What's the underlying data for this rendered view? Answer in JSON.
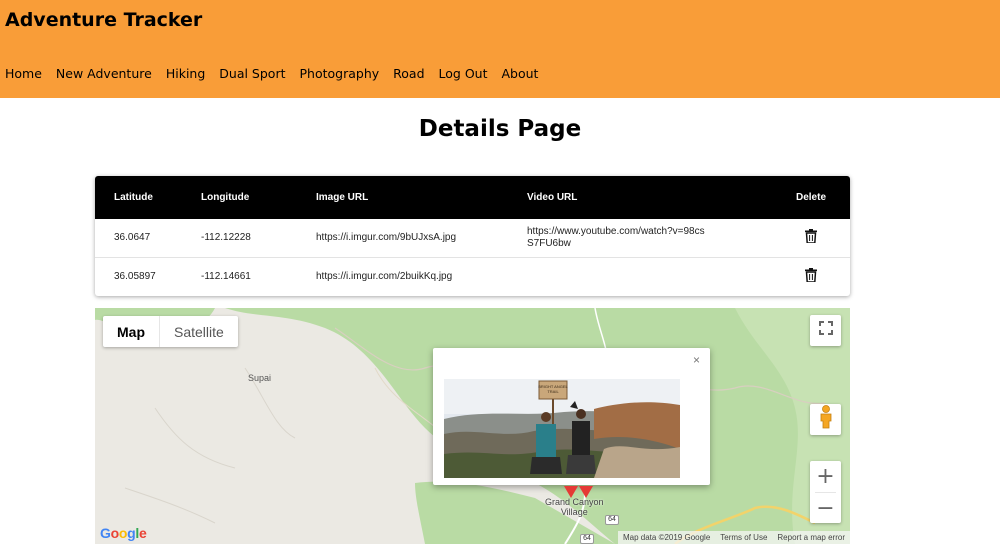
{
  "header": {
    "title": "Adventure Tracker",
    "nav": [
      "Home",
      "New Adventure",
      "Hiking",
      "Dual Sport",
      "Photography",
      "Road",
      "Log Out",
      "About"
    ],
    "bg_color": "#f99d38"
  },
  "page_title": "Details Page",
  "table": {
    "columns": [
      "Latitude",
      "Longitude",
      "Image URL",
      "Video URL",
      "Delete"
    ],
    "rows": [
      {
        "lat": "36.0647",
        "lng": "-112.12228",
        "image": "https://i.imgur.com/9bUJxsA.jpg",
        "video": "https://www.youtube.com/watch?v=98csS7FU6bw",
        "delete_icon": "trash-icon"
      },
      {
        "lat": "36.05897",
        "lng": "-112.14661",
        "image": "https://i.imgur.com/2buikKq.jpg",
        "video": "",
        "delete_icon": "trash-icon"
      }
    ]
  },
  "map": {
    "type_control": {
      "map": "Map",
      "satellite": "Satellite",
      "selected": "Map"
    },
    "places": {
      "supai": "Supai",
      "grand_canyon_line1": "Grand Canyon",
      "grand_canyon_line2": "Village",
      "route": "64"
    },
    "infowindow": {
      "close": "×",
      "photo_sign_line1": "BRIGHT ANGEL",
      "photo_sign_line2": "TRAIL"
    },
    "zoom_in": "+",
    "zoom_out": "−",
    "footer": {
      "data": "Map data ©2019 Google",
      "terms": "Terms of Use",
      "report": "Report a map error"
    },
    "logo": "Google",
    "marker_color": "#e53935"
  }
}
